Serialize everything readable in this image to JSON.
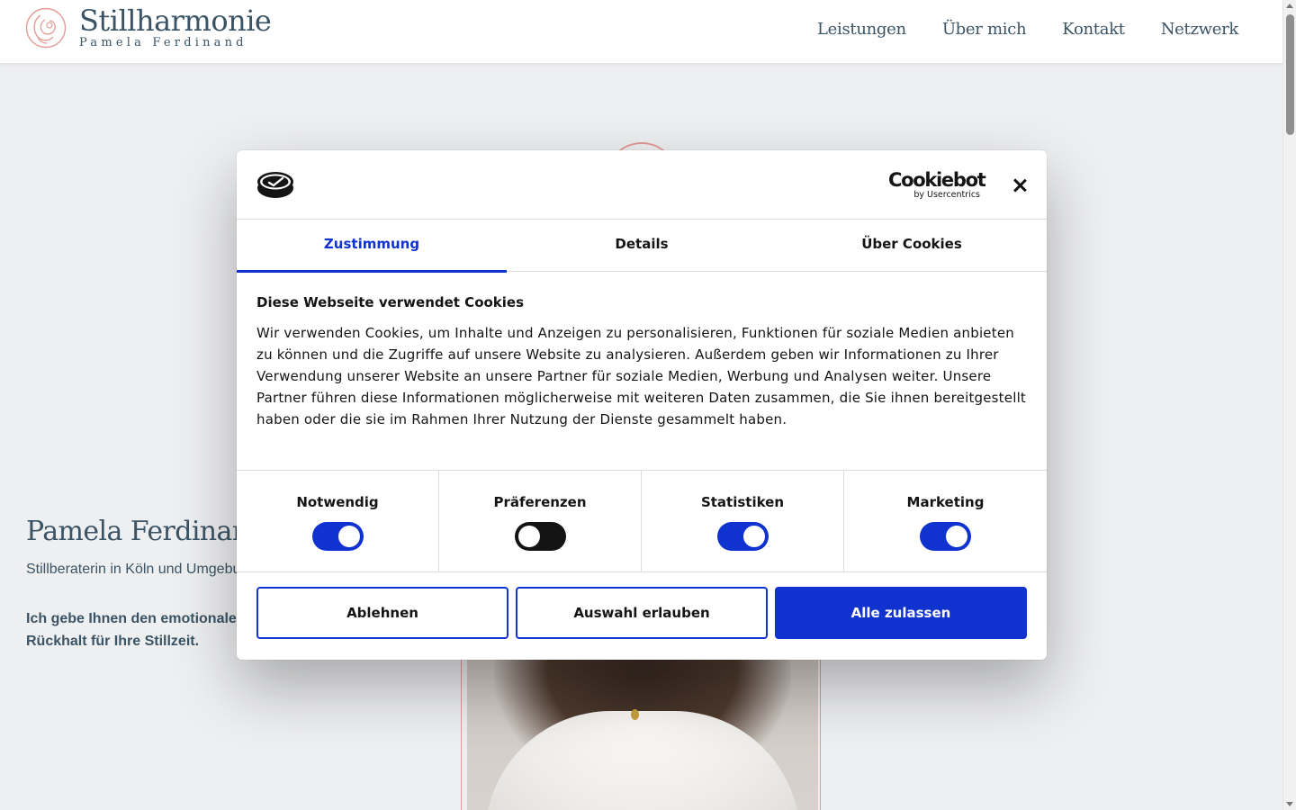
{
  "site": {
    "logo_title": "Stillharmonie",
    "logo_subtitle": "Pamela Ferdinand",
    "nav": [
      "Leistungen",
      "Über mich",
      "Kontakt",
      "Netzwerk"
    ]
  },
  "hero": {
    "name": "Pamela Ferdinand",
    "role": "Stillberaterin in Köln und Umgebung",
    "claim": "Ich gebe Ihnen den emotionalen\nRückhalt für Ihre Stillzeit."
  },
  "cookie_dialog": {
    "brand_name": "Cookiebot",
    "brand_by": "by Usercentrics",
    "tabs": [
      {
        "label": "Zustimmung",
        "active": true
      },
      {
        "label": "Details",
        "active": false
      },
      {
        "label": "Über Cookies",
        "active": false
      }
    ],
    "title": "Diese Webseite verwendet Cookies",
    "description": "Wir verwenden Cookies, um Inhalte und Anzeigen zu personalisieren, Funktionen für soziale Medien anbieten zu können und die Zugriffe auf unsere Website zu analysieren. Außerdem geben wir Informationen zu Ihrer Verwendung unserer Website an unsere Partner für soziale Medien, Werbung und Analysen weiter. Unsere Partner führen diese Informationen möglicherweise mit weiteren Daten zusammen, die Sie ihnen bereitgestellt haben oder die sie im Rahmen Ihrer Nutzung der Dienste gesammelt haben.",
    "categories": [
      {
        "label": "Notwendig",
        "enabled": true
      },
      {
        "label": "Präferenzen",
        "enabled": false
      },
      {
        "label": "Statistiken",
        "enabled": true
      },
      {
        "label": "Marketing",
        "enabled": true
      }
    ],
    "buttons": {
      "decline": "Ablehnen",
      "allow_selection": "Auswahl erlauben",
      "allow_all": "Alle zulassen"
    }
  },
  "colors": {
    "accent_blue": "#1032cf",
    "brand_slate": "#3a5465",
    "brand_rose": "#e39b96",
    "page_bg": "#eeeff1"
  },
  "icons": [
    "stillharmonie-logo-icon",
    "cookiebot-logo-icon",
    "close-icon"
  ]
}
